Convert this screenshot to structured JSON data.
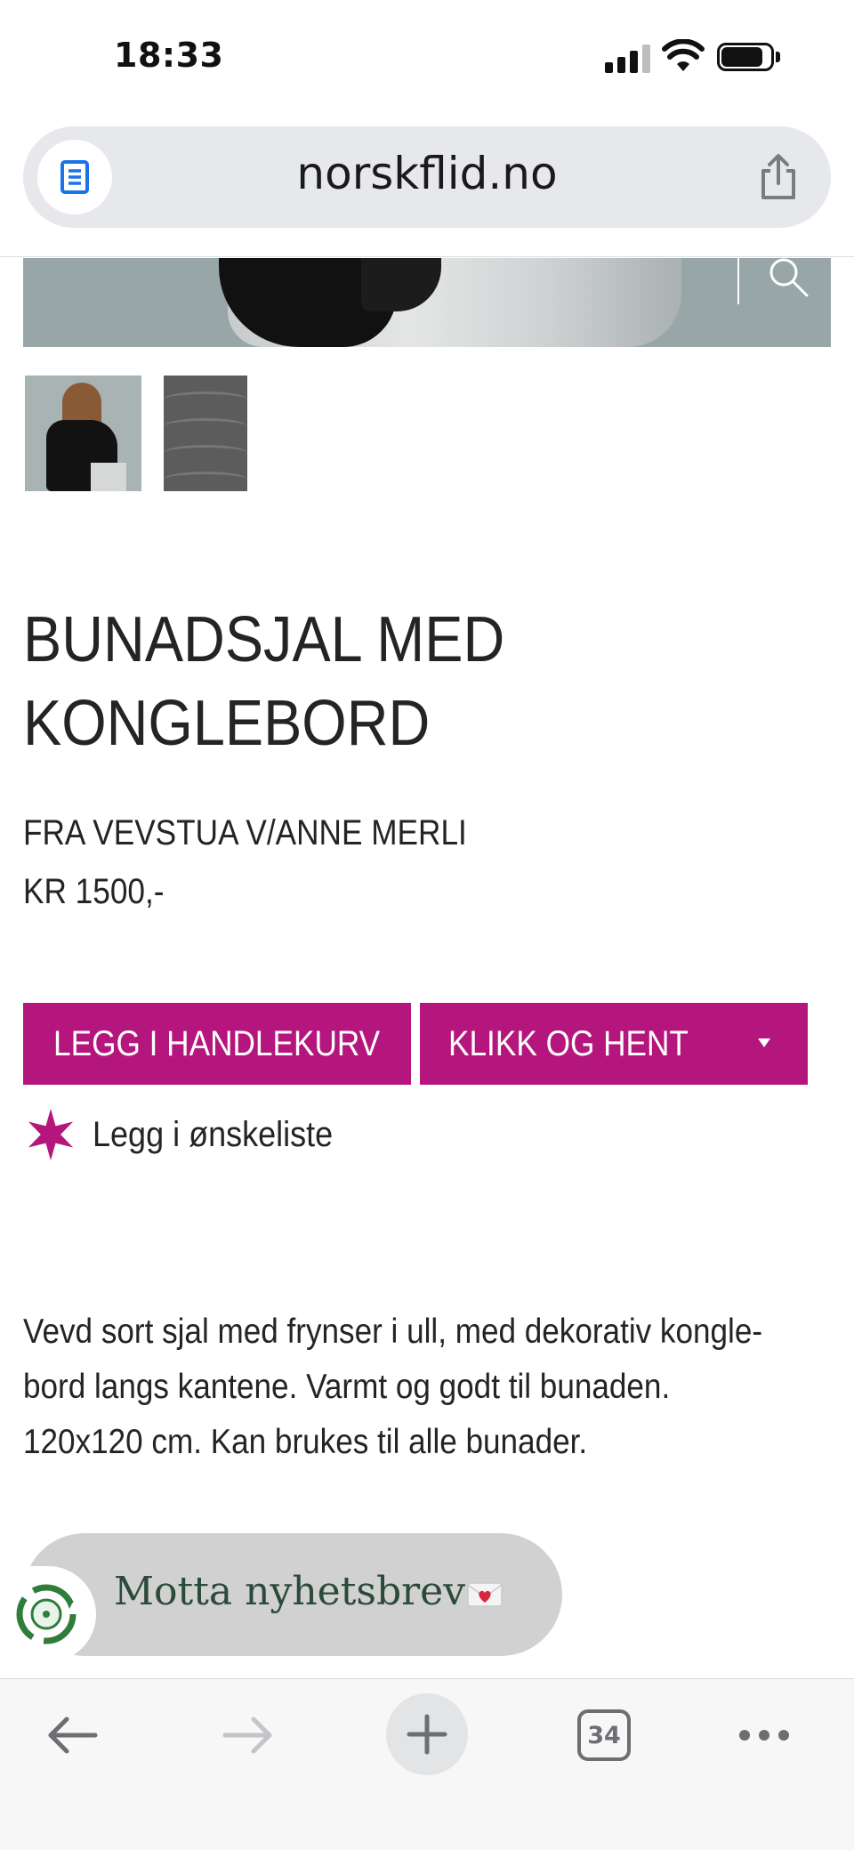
{
  "status_bar": {
    "time": "18:33",
    "icons": [
      "signal-icon",
      "wifi-icon",
      "battery-icon"
    ]
  },
  "browser": {
    "url": "norskflid.no",
    "icons": [
      "reader-mode-icon",
      "share-icon"
    ]
  },
  "hero": {
    "icons": [
      "search-icon"
    ]
  },
  "gallery": {
    "thumbnails": [
      "thumbnail-model",
      "thumbnail-pattern"
    ]
  },
  "product": {
    "title_line1": "BUNADSJAL MED",
    "title_line2": "KONGLEBORD",
    "maker": "FRA VEVSTUA V/ANNE MERLI",
    "price": "KR 1500,-",
    "add_to_cart_label": "LEGG I HANDLEKURV",
    "click_collect_label": "KLIKK OG HENT",
    "wishlist_label": "Legg i ønskeliste",
    "description": "Vevd sort sjal med frynser i ull, med dekorativ kongle-bord langs kantene. Varmt og godt til bunaden. 120x120 cm. Kan brukes til alle bunader."
  },
  "newsletter": {
    "label": "Motta nyhetsbrev",
    "close": "×"
  },
  "toolbar": {
    "tab_count": "34",
    "icons": [
      "back-icon",
      "forward-icon",
      "new-tab-icon",
      "tabs-icon",
      "more-icon"
    ]
  },
  "colors": {
    "accent": "#b5167d",
    "newsletter_bg": "#d0d1d0",
    "newsletter_text": "#2b4a3a",
    "url_bar_bg": "#e7e8ec",
    "reader_icon": "#1a73e8"
  }
}
